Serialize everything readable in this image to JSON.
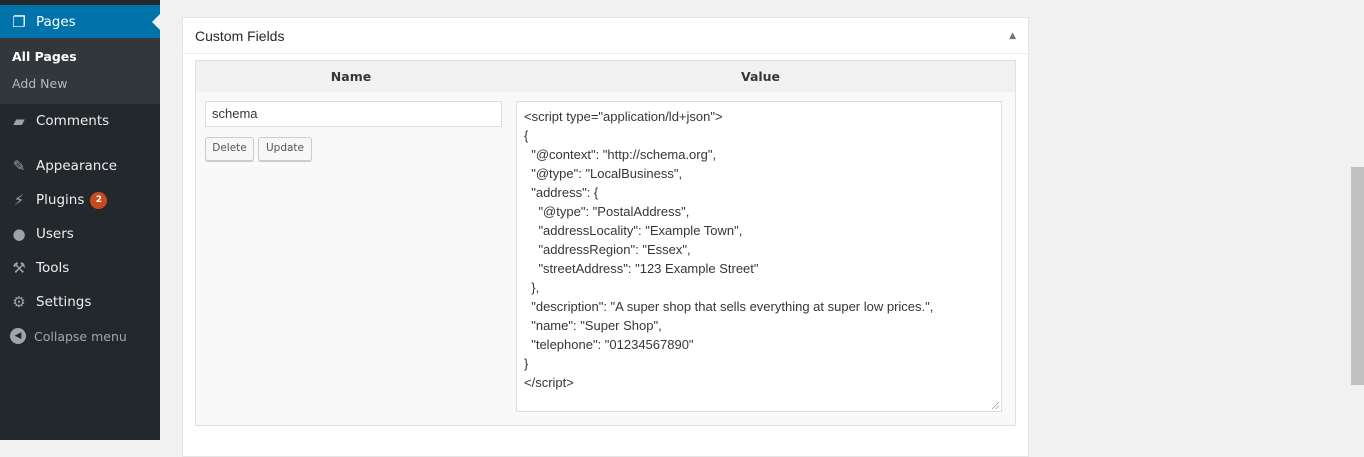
{
  "sidebar": {
    "pages": "Pages",
    "all_pages": "All Pages",
    "add_new": "Add New",
    "comments": "Comments",
    "appearance": "Appearance",
    "plugins": "Plugins",
    "plugins_badge": "2",
    "users": "Users",
    "tools": "Tools",
    "settings": "Settings",
    "collapse": "Collapse menu"
  },
  "panel": {
    "title": "Custom Fields",
    "col_name": "Name",
    "col_value": "Value",
    "field_name": "schema",
    "delete": "Delete",
    "update": "Update",
    "field_value": "<script type=\"application/ld+json\">\n{\n  \"@context\": \"http://schema.org\",\n  \"@type\": \"LocalBusiness\",\n  \"address\": {\n    \"@type\": \"PostalAddress\",\n    \"addressLocality\": \"Example Town\",\n    \"addressRegion\": \"Essex\",\n    \"streetAddress\": \"123 Example Street\"\n  },\n  \"description\": \"A super shop that sells everything at super low prices.\",\n  \"name\": \"Super Shop\",\n  \"telephone\": \"01234567890\"\n}\n</script>"
  }
}
